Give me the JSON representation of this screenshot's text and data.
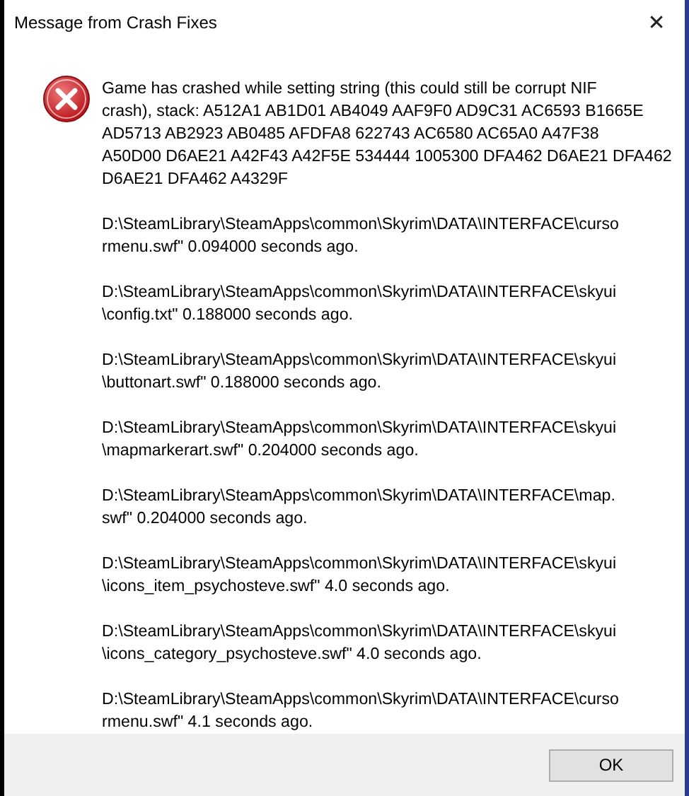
{
  "window": {
    "title": "Message from Crash Fixes",
    "close_label": "✕"
  },
  "message": {
    "kind": "error",
    "paragraphs": [
      [
        "Game has crashed while setting string (this could still be corrupt NIF",
        "crash), stack: A512A1 AB1D01 AB4049 AAF9F0 AD9C31 AC6593 B1665E",
        "AD5713 AB2923 AB0485 AFDFA8 622743 AC6580 AC65A0 A47F38",
        "A50D00 D6AE21 A42F43 A42F5E 534444 1005300 DFA462 D6AE21 DFA462",
        "D6AE21 DFA462 A4329F"
      ],
      [
        "D:\\SteamLibrary\\SteamApps\\common\\Skyrim\\DATA\\INTERFACE\\curso",
        "rmenu.swf\" 0.094000 seconds ago."
      ],
      [
        "D:\\SteamLibrary\\SteamApps\\common\\Skyrim\\DATA\\INTERFACE\\skyui",
        "\\config.txt\" 0.188000 seconds ago."
      ],
      [
        "D:\\SteamLibrary\\SteamApps\\common\\Skyrim\\DATA\\INTERFACE\\skyui",
        "\\buttonart.swf\" 0.188000 seconds ago."
      ],
      [
        "D:\\SteamLibrary\\SteamApps\\common\\Skyrim\\DATA\\INTERFACE\\skyui",
        "\\mapmarkerart.swf\" 0.204000 seconds ago."
      ],
      [
        "D:\\SteamLibrary\\SteamApps\\common\\Skyrim\\DATA\\INTERFACE\\map.",
        "swf\" 0.204000 seconds ago."
      ],
      [
        "D:\\SteamLibrary\\SteamApps\\common\\Skyrim\\DATA\\INTERFACE\\skyui",
        "\\icons_item_psychosteve.swf\" 4.0 seconds ago."
      ],
      [
        "D:\\SteamLibrary\\SteamApps\\common\\Skyrim\\DATA\\INTERFACE\\skyui",
        "\\icons_category_psychosteve.swf\" 4.0 seconds ago."
      ],
      [
        "D:\\SteamLibrary\\SteamApps\\common\\Skyrim\\DATA\\INTERFACE\\curso",
        "rmenu.swf\" 4.1 seconds ago."
      ]
    ]
  },
  "buttons": [
    "OK"
  ]
}
